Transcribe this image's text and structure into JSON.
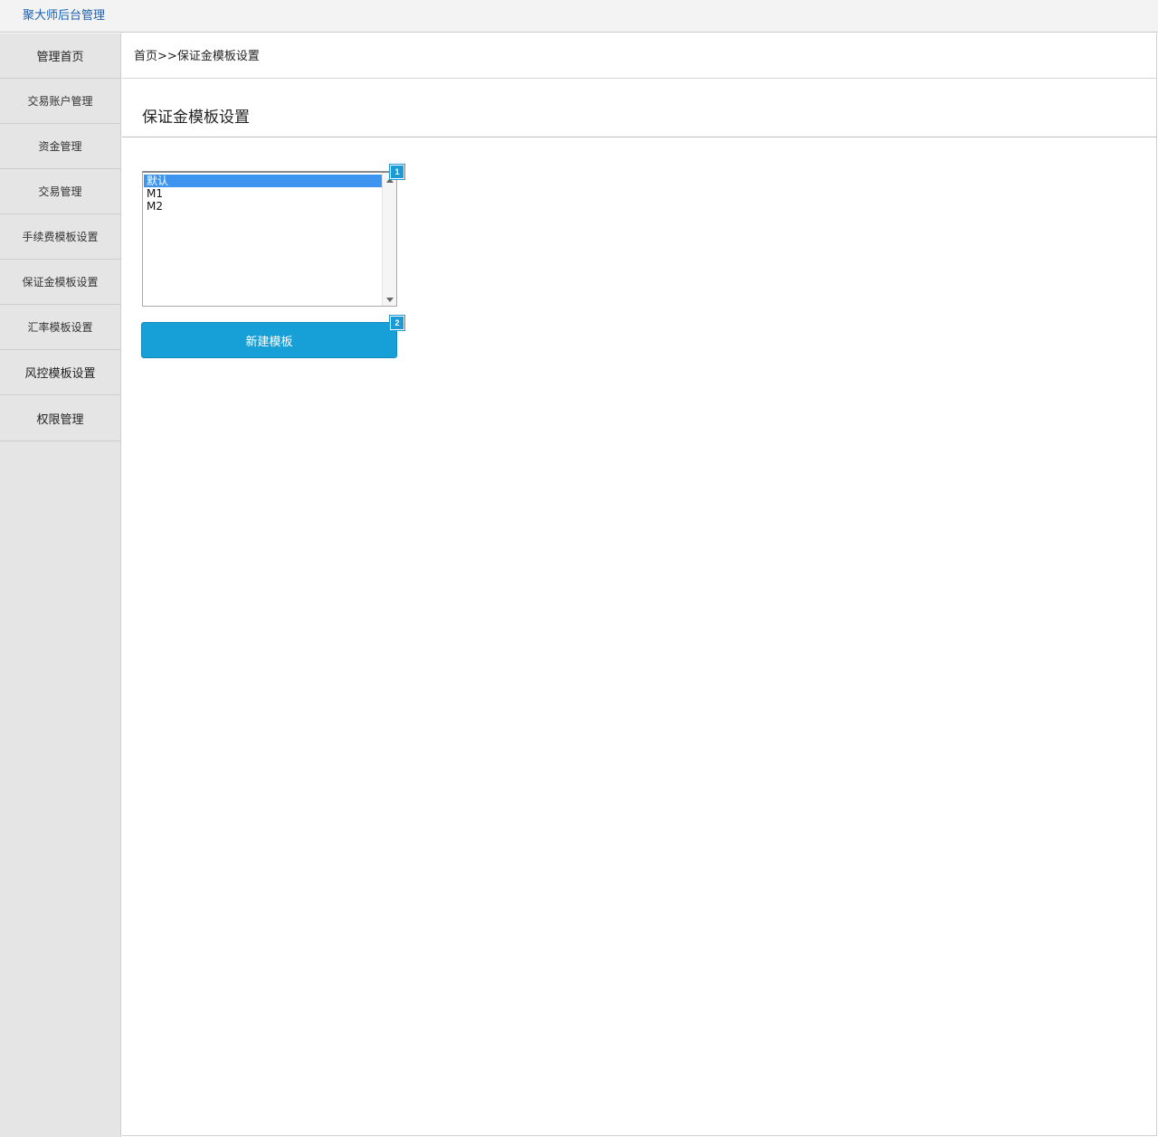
{
  "app": {
    "title": "聚大师后台管理"
  },
  "sidebar": {
    "items": [
      {
        "label": "管理首页"
      },
      {
        "label": "交易账户管理"
      },
      {
        "label": "资金管理"
      },
      {
        "label": "交易管理"
      },
      {
        "label": "手续费模板设置"
      },
      {
        "label": "保证金模板设置"
      },
      {
        "label": "汇率模板设置"
      },
      {
        "label": "风控模板设置"
      },
      {
        "label": "权限管理"
      }
    ]
  },
  "breadcrumb": {
    "home": "首页",
    "separator": ">>",
    "current": "保证金模板设置"
  },
  "page": {
    "title": "保证金模板设置"
  },
  "template_list": {
    "options": [
      "默认",
      "M1",
      "M2"
    ],
    "selected": "默认",
    "badge": "1"
  },
  "new_template_button": {
    "label": "新建模板",
    "badge": "2"
  },
  "colors": {
    "accent": "#179fd8",
    "title_blue": "#1a5fb4",
    "selection": "#3d95f0",
    "sidebar_bg": "#e5e5e5"
  }
}
